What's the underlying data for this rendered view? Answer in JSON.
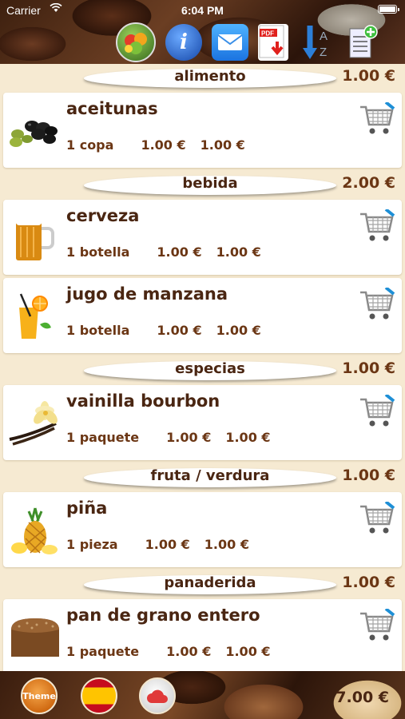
{
  "status_bar": {
    "carrier": "Carrier",
    "time": "6:04 PM"
  },
  "toolbar": {
    "icons": [
      "fruits-basket-icon",
      "info-icon",
      "mail-icon",
      "pdf-icon",
      "sort-az-icon",
      "add-list-icon"
    ]
  },
  "sections": [
    {
      "title": "alimento",
      "total": "1.00 €",
      "items": [
        {
          "name": "aceitunas",
          "qty": "1 copa",
          "price": "1.00 €",
          "total": "1.00 €",
          "icon": "olives-icon"
        }
      ]
    },
    {
      "title": "bebida",
      "total": "2.00 €",
      "items": [
        {
          "name": "cerveza",
          "qty": "1 botella",
          "price": "1.00 €",
          "total": "1.00 €",
          "icon": "beer-icon"
        },
        {
          "name": "jugo de manzana",
          "qty": "1 botella",
          "price": "1.00 €",
          "total": "1.00 €",
          "icon": "juice-icon"
        }
      ]
    },
    {
      "title": "especias",
      "total": "1.00 €",
      "items": [
        {
          "name": "vainilla bourbon",
          "qty": "1 paquete",
          "price": "1.00 €",
          "total": "1.00 €",
          "icon": "vanilla-icon"
        }
      ]
    },
    {
      "title": "fruta / verdura",
      "total": "1.00 €",
      "items": [
        {
          "name": "piña",
          "qty": "1 pieza",
          "price": "1.00 €",
          "total": "1.00 €",
          "icon": "pineapple-icon"
        }
      ]
    },
    {
      "title": "panaderida",
      "total": "1.00 €",
      "items": [
        {
          "name": "pan de grano entero",
          "qty": "1 paquete",
          "price": "1.00 €",
          "total": "1.00 €",
          "icon": "bread-icon"
        }
      ]
    }
  ],
  "bottom_bar": {
    "theme_label": "Theme",
    "grand_total": "7.00 €"
  },
  "colors": {
    "text_brown": "#4a2612",
    "price_brown": "#6b3614",
    "list_background": "#f6ead2"
  }
}
